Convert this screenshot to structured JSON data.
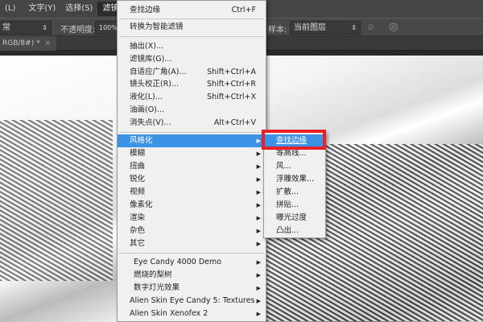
{
  "menubar": {
    "items": [
      "(L)",
      "文字(Y)",
      "选择(S)",
      "滤镜(T)"
    ]
  },
  "options": {
    "blend_mode": "常",
    "opacity_label": "不透明度:",
    "opacity_value": "100%",
    "sample_label": "样本:",
    "sample_value": "当前图层"
  },
  "tab": {
    "label": "RGB/8#) *",
    "close": "×"
  },
  "filter_menu": {
    "top": [
      {
        "label": "查找边缘",
        "shortcut": "Ctrl+F"
      },
      {
        "label": "转换为智能滤镜"
      }
    ],
    "group1": [
      {
        "label": "抽出(X)..."
      },
      {
        "label": "滤镜库(G)..."
      },
      {
        "label": "自适应广角(A)...",
        "shortcut": "Shift+Ctrl+A"
      },
      {
        "label": "镜头校正(R)...",
        "shortcut": "Shift+Ctrl+R"
      },
      {
        "label": "液化(L)...",
        "shortcut": "Shift+Ctrl+X"
      },
      {
        "label": "油画(O)..."
      },
      {
        "label": "消失点(V)...",
        "shortcut": "Alt+Ctrl+V"
      }
    ],
    "group2": [
      "风格化",
      "模糊",
      "扭曲",
      "锐化",
      "视频",
      "像素化",
      "渲染",
      "杂色",
      "其它"
    ],
    "group3": [
      "Eye Candy 4000 Demo",
      "燃烧的梨树",
      "数字灯光效果",
      "Alien Skin Eye Candy 5: Textures",
      "Alien Skin Xenofex 2"
    ]
  },
  "stylize_submenu": [
    "查找边缘",
    "等高线...",
    "风...",
    "浮雕效果...",
    "扩散...",
    "拼贴...",
    "曝光过度",
    "凸出..."
  ],
  "colors": {
    "highlight": "#3c93e6",
    "callout": "#e8202a"
  }
}
